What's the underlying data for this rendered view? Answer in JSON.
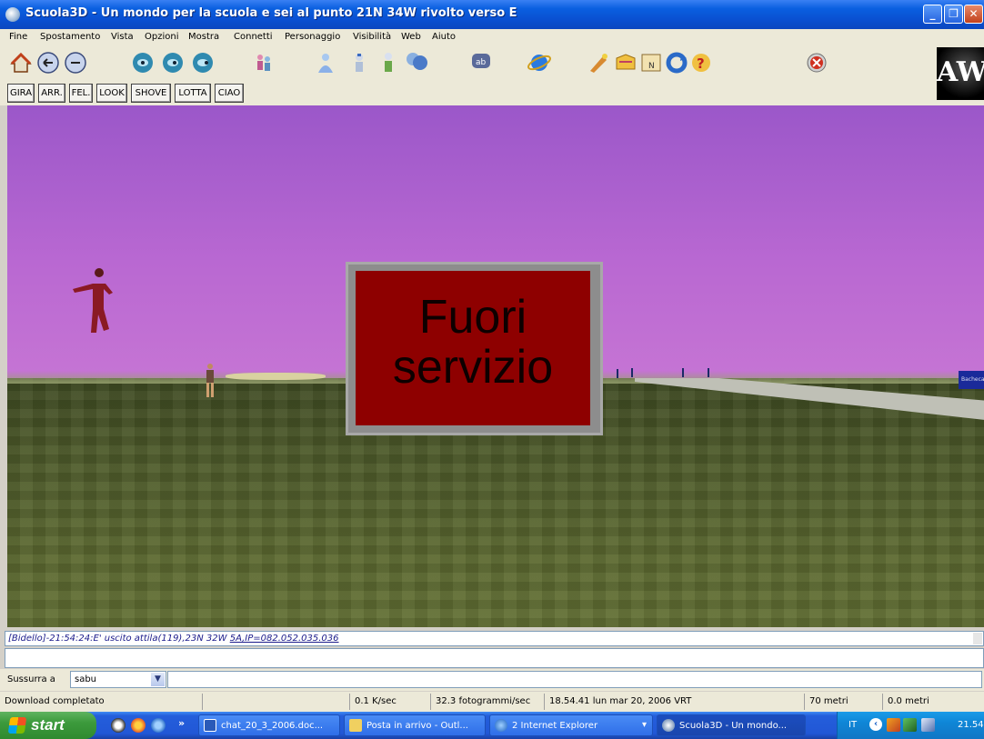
{
  "window": {
    "title": "Scuola3D - Un mondo per la scuola e sei al punto 21N 34W rivolto verso E",
    "minimize": "_",
    "maximize": "❐",
    "close": "✕"
  },
  "menu": [
    "Fine",
    "Spostamento",
    "Vista",
    "Opzioni",
    "Mostra",
    "Connetti",
    "Personaggio",
    "Visibilità",
    "Web",
    "Aiuto"
  ],
  "gestures": [
    "GIRA",
    "ARR.",
    "FEL.",
    "LOOK",
    "SHOVE",
    "LOTTA",
    "CIAO"
  ],
  "logo_text": "AW",
  "scene": {
    "sign_text": "Fuori servizio",
    "far_sign_text": "Bacheca"
  },
  "chat": {
    "log_prefix": "[Bidello]-21:54:24:E' uscito attila(119),23N 32W ",
    "log_link": "5A,IP=082.052.035.036",
    "input_value": "",
    "whisper_label": "Sussurra a",
    "whisper_target": "sabu",
    "whisper_arrow": "▼"
  },
  "status": {
    "message": "Download completato",
    "bandwidth": "0.1 K/sec",
    "fps": "32.3 fotogrammi/sec",
    "datetime": "18.54.41 lun mar 20, 2006 VRT",
    "visibility": "70 metri",
    "altitude": "0.0 metri"
  },
  "taskbar": {
    "start": "start",
    "overflow": "»",
    "tasks": [
      "chat_20_3_2006.doc...",
      "Posta in arrivo - Outl...",
      "2 Internet Explorer",
      "Scuola3D - Un mondo..."
    ],
    "ie_dropdown": "▾",
    "language": "IT",
    "tray_chevron": "‹",
    "clock": "21.54"
  },
  "colors": {
    "sky_top": "#9b57c9",
    "sign_red": "#8e0000",
    "titlebar_blue": "#0a5fe0",
    "taskbar_blue": "#245edb",
    "start_green": "#3c9a3c"
  }
}
